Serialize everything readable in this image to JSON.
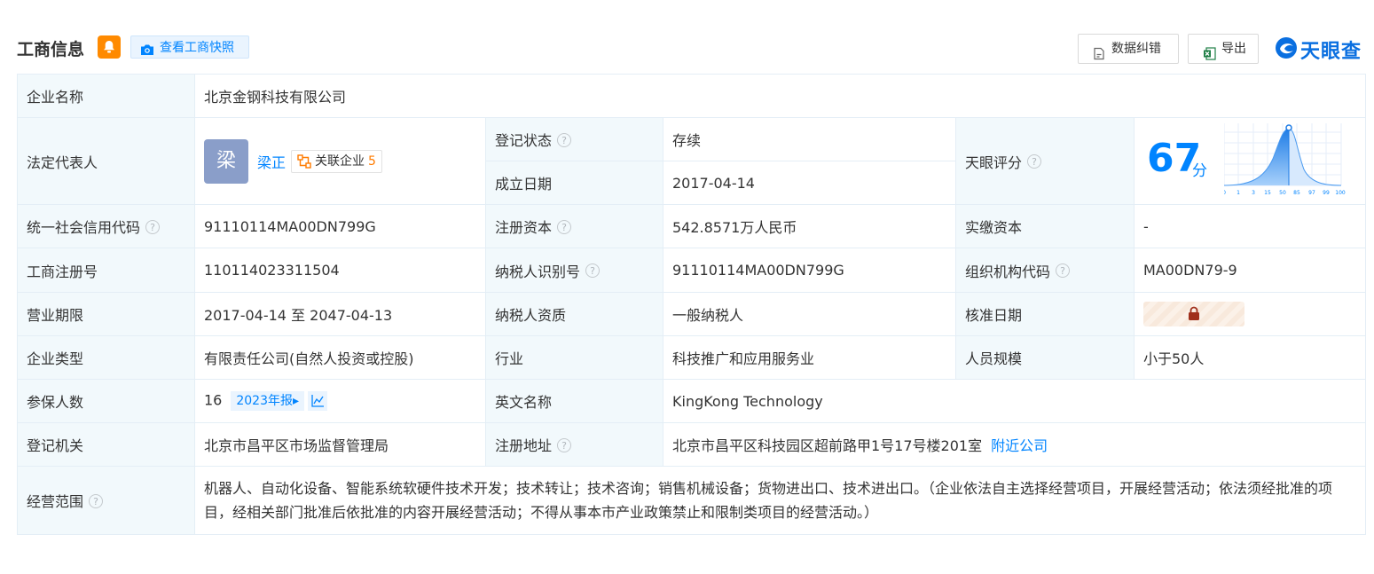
{
  "header": {
    "title": "工商信息",
    "snapshot_label": "查看工商快照",
    "error_label": "数据纠错",
    "export_label": "导出",
    "logo_text": "天眼查",
    "accent_color": "#0084ff",
    "bell_color": "#ff8a00"
  },
  "company": {
    "name_label": "企业名称",
    "name": "北京金钢科技有限公司",
    "legal_rep_label": "法定代表人",
    "legal_rep_avatar": "梁",
    "legal_rep_name": "梁正",
    "assoc_label": "关联企业",
    "assoc_count": "5",
    "status_label": "登记状态",
    "status": "存续",
    "founded_label": "成立日期",
    "founded": "2017-04-14",
    "score_label": "天眼评分",
    "score": "67",
    "score_unit": "分",
    "score_axis": [
      "0",
      "1",
      "3",
      "15",
      "50",
      "85",
      "97",
      "99",
      "100"
    ],
    "credit_code_label": "统一社会信用代码",
    "credit_code": "91110114MA00DN799G",
    "reg_capital_label": "注册资本",
    "reg_capital": "542.8571万人民币",
    "paid_capital_label": "实缴资本",
    "paid_capital": "-",
    "reg_number_label": "工商注册号",
    "reg_number": "110114023311504",
    "taxpayer_id_label": "纳税人识别号",
    "taxpayer_id": "91110114MA00DN799G",
    "org_code_label": "组织机构代码",
    "org_code": "MA00DN79-9",
    "term_label": "营业期限",
    "term": "2017-04-14 至 2047-04-13",
    "taxpayer_qual_label": "纳税人资质",
    "taxpayer_qual": "一般纳税人",
    "approval_date_label": "核准日期",
    "type_label": "企业类型",
    "type": "有限责任公司(自然人投资或控股)",
    "industry_label": "行业",
    "industry": "科技推广和应用服务业",
    "staff_size_label": "人员规模",
    "staff_size": "小于50人",
    "insured_label": "参保人数",
    "insured": "16",
    "report_tag": "2023年报",
    "english_name_label": "英文名称",
    "english_name": "KingKong Technology",
    "authority_label": "登记机关",
    "authority": "北京市昌平区市场监督管理局",
    "address_label": "注册地址",
    "address": "北京市昌平区科技园区超前路甲1号17号楼201室",
    "nearby_label": "附近公司",
    "scope_label": "经营范围",
    "scope": "机器人、自动化设备、智能系统软硬件技术开发；技术转让；技术咨询；销售机械设备；货物进出口、技术进出口。（企业依法自主选择经营项目，开展经营活动；依法须经批准的项目，经相关部门批准后依批准的内容开展经营活动；不得从事本市产业政策禁止和限制类项目的经营活动。）"
  }
}
